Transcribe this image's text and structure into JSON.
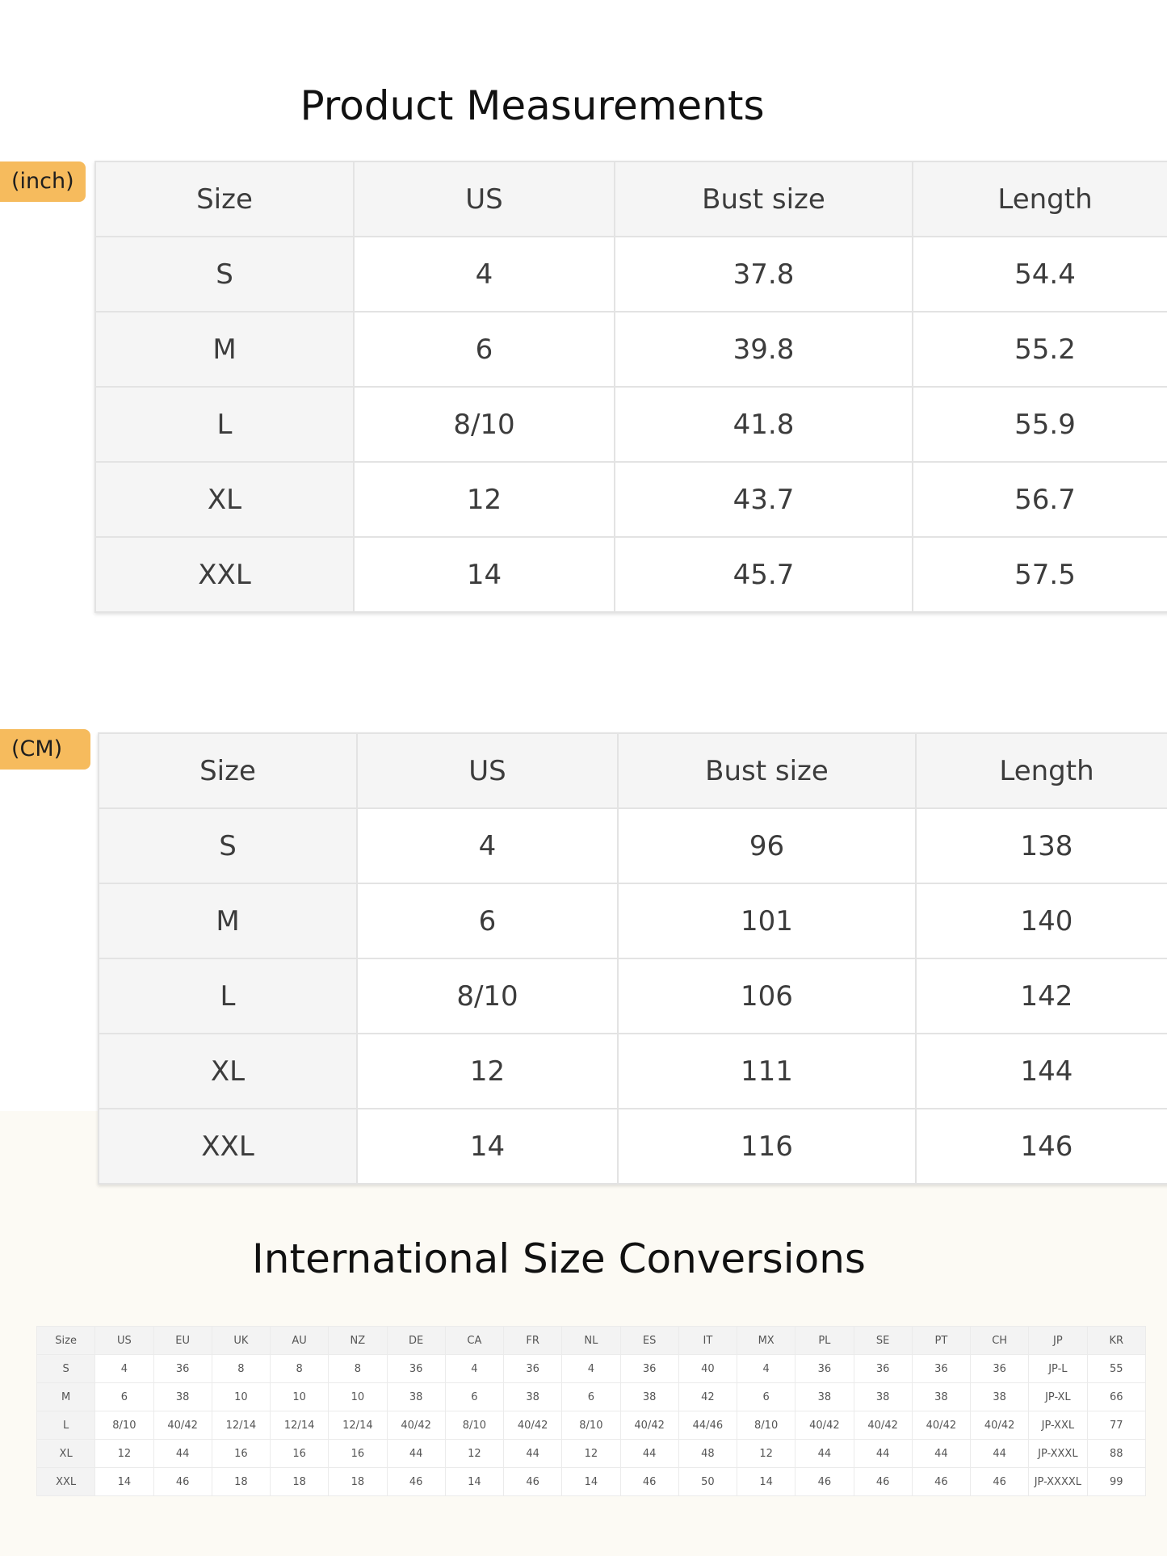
{
  "titles": {
    "main": "Product Measurements",
    "international": "International Size Conversions"
  },
  "unit_tags": {
    "inch": "(inch)",
    "cm": "(CM)"
  },
  "measure_headers": [
    "Size",
    "US",
    "Bust size",
    "Length"
  ],
  "inch_rows": [
    [
      "S",
      "4",
      "37.8",
      "54.4"
    ],
    [
      "M",
      "6",
      "39.8",
      "55.2"
    ],
    [
      "L",
      "8/10",
      "41.8",
      "55.9"
    ],
    [
      "XL",
      "12",
      "43.7",
      "56.7"
    ],
    [
      "XXL",
      "14",
      "45.7",
      "57.5"
    ]
  ],
  "cm_rows": [
    [
      "S",
      "4",
      "96",
      "138"
    ],
    [
      "M",
      "6",
      "101",
      "140"
    ],
    [
      "L",
      "8/10",
      "106",
      "142"
    ],
    [
      "XL",
      "12",
      "111",
      "144"
    ],
    [
      "XXL",
      "14",
      "116",
      "146"
    ]
  ],
  "intl_headers": [
    "Size",
    "US",
    "EU",
    "UK",
    "AU",
    "NZ",
    "DE",
    "CA",
    "FR",
    "NL",
    "ES",
    "IT",
    "MX",
    "PL",
    "SE",
    "PT",
    "CH",
    "JP",
    "KR"
  ],
  "intl_rows": [
    [
      "S",
      "4",
      "36",
      "8",
      "8",
      "8",
      "36",
      "4",
      "36",
      "4",
      "36",
      "40",
      "4",
      "36",
      "36",
      "36",
      "36",
      "JP-L",
      "55"
    ],
    [
      "M",
      "6",
      "38",
      "10",
      "10",
      "10",
      "38",
      "6",
      "38",
      "6",
      "38",
      "42",
      "6",
      "38",
      "38",
      "38",
      "38",
      "JP-XL",
      "66"
    ],
    [
      "L",
      "8/10",
      "40/42",
      "12/14",
      "12/14",
      "12/14",
      "40/42",
      "8/10",
      "40/42",
      "8/10",
      "40/42",
      "44/46",
      "8/10",
      "40/42",
      "40/42",
      "40/42",
      "40/42",
      "JP-XXL",
      "77"
    ],
    [
      "XL",
      "12",
      "44",
      "16",
      "16",
      "16",
      "44",
      "12",
      "44",
      "12",
      "44",
      "48",
      "12",
      "44",
      "44",
      "44",
      "44",
      "JP-XXXL",
      "88"
    ],
    [
      "XXL",
      "14",
      "46",
      "18",
      "18",
      "18",
      "46",
      "14",
      "46",
      "14",
      "46",
      "50",
      "14",
      "46",
      "46",
      "46",
      "46",
      "JP-XXXXL",
      "99"
    ]
  ]
}
